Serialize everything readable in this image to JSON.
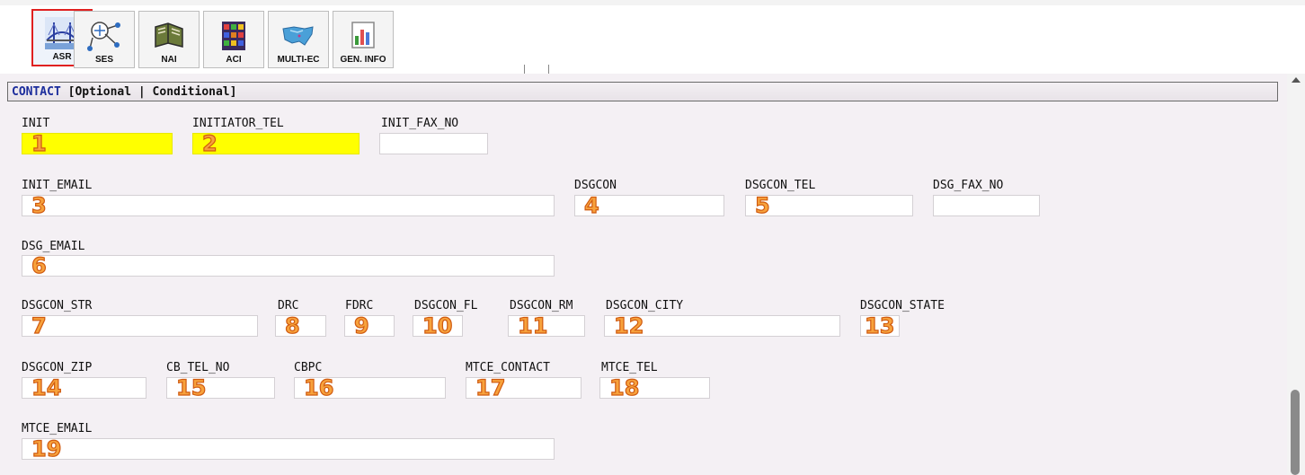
{
  "toolbar": {
    "buttons": [
      {
        "label": "ASR",
        "active": true,
        "icon": "bridge-icon"
      },
      {
        "label": "SES",
        "icon": "network-icon"
      },
      {
        "label": "NAI",
        "icon": "book-icon"
      },
      {
        "label": "ACI",
        "icon": "circuit-icon"
      },
      {
        "label": "MULTI-EC",
        "icon": "us-map-icon"
      },
      {
        "label": "GEN. INFO",
        "icon": "bar-chart-icon"
      }
    ]
  },
  "section": {
    "name": "CONTACT",
    "qualifier": "[Optional | Conditional]"
  },
  "fields": {
    "init": {
      "label": "INIT",
      "marker": "1",
      "required": true
    },
    "initiator_tel": {
      "label": "INITIATOR_TEL",
      "marker": "2",
      "required": true
    },
    "init_fax_no": {
      "label": "INIT_FAX_NO"
    },
    "init_email": {
      "label": "INIT_EMAIL",
      "marker": "3"
    },
    "dsgcon": {
      "label": "DSGCON",
      "marker": "4"
    },
    "dsgcon_tel": {
      "label": "DSGCON_TEL",
      "marker": "5"
    },
    "dsg_fax_no": {
      "label": "DSG_FAX_NO"
    },
    "dsg_email": {
      "label": "DSG_EMAIL",
      "marker": "6"
    },
    "dsgcon_str": {
      "label": "DSGCON_STR",
      "marker": "7"
    },
    "drc": {
      "label": "DRC",
      "marker": "8"
    },
    "fdrc": {
      "label": "FDRC",
      "marker": "9"
    },
    "dsgcon_fl": {
      "label": "DSGCON_FL",
      "marker": "10"
    },
    "dsgcon_rm": {
      "label": "DSGCON_RM",
      "marker": "11"
    },
    "dsgcon_city": {
      "label": "DSGCON_CITY",
      "marker": "12"
    },
    "dsgcon_state": {
      "label": "DSGCON_STATE",
      "marker": "13"
    },
    "dsgcon_zip": {
      "label": "DSGCON_ZIP",
      "marker": "14"
    },
    "cb_tel_no": {
      "label": "CB_TEL_NO",
      "marker": "15"
    },
    "cbpc": {
      "label": "CBPC",
      "marker": "16"
    },
    "mtce_contact": {
      "label": "MTCE_CONTACT",
      "marker": "17"
    },
    "mtce_tel": {
      "label": "MTCE_TEL",
      "marker": "18"
    },
    "mtce_email": {
      "label": "MTCE_EMAIL",
      "marker": "19"
    }
  },
  "colors": {
    "required_field": "#ffff00",
    "marker": "#f7a23c",
    "section_name": "#1c2d9c"
  }
}
